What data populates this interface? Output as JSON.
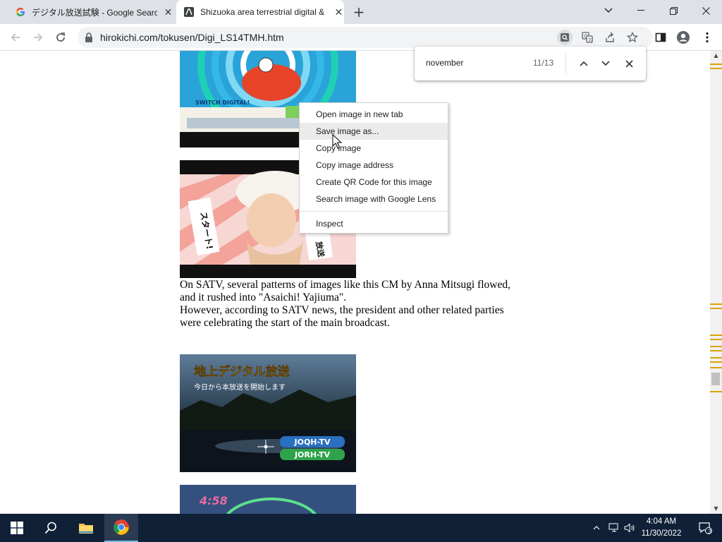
{
  "browser": {
    "tabs": [
      {
        "title": "デジタル放送試験 - Google Search",
        "favicon": "google-g-icon",
        "active": false
      },
      {
        "title": "Shizuoka area terrestrial digital &",
        "favicon": "page-icon",
        "active": true
      }
    ],
    "new_tab_label": "+",
    "url": "hirokichi.com/tokusen/Digi_LS14TMH.htm"
  },
  "find_bar": {
    "query": "november",
    "count": "11/13"
  },
  "context_menu": {
    "items": [
      {
        "label": "Open image in new tab"
      },
      {
        "label": "Save image as...",
        "hovered": true
      },
      {
        "label": "Copy image"
      },
      {
        "label": "Copy image address"
      },
      {
        "label": "Create QR Code for this image"
      },
      {
        "label": "Search image with Google Lens"
      }
    ],
    "inspect_label": "Inspect"
  },
  "page": {
    "paragraph": {
      "line1": "On SATV, several patterns of images like this CM by Anna Mitsugi flowed,",
      "line2": "and it rushed into \"Asaichi! Yajiuma\".",
      "line3": "However, according to SATV news, the president and other related parties",
      "line4": "were celebrating the start of the main broadcast."
    },
    "image1": {
      "text": "SWITCH DIGITAL!"
    },
    "image2": {
      "text_left": "スタート!",
      "text_right": "放送"
    },
    "image3": {
      "title": "地上デジタル放送",
      "subtitle": "今日から本放送を開始します",
      "badge1": "JOQH-TV",
      "badge2": "JORH-TV"
    },
    "image4": {
      "time": "4:58"
    }
  },
  "taskbar": {
    "time": "4:04 AM",
    "date": "11/30/2022",
    "notification_count": "3"
  },
  "colors": {
    "accent_find_mark": "#d9a400",
    "taskbar_bg": "#0f2037",
    "tabstrip_bg": "#dee1e6"
  }
}
